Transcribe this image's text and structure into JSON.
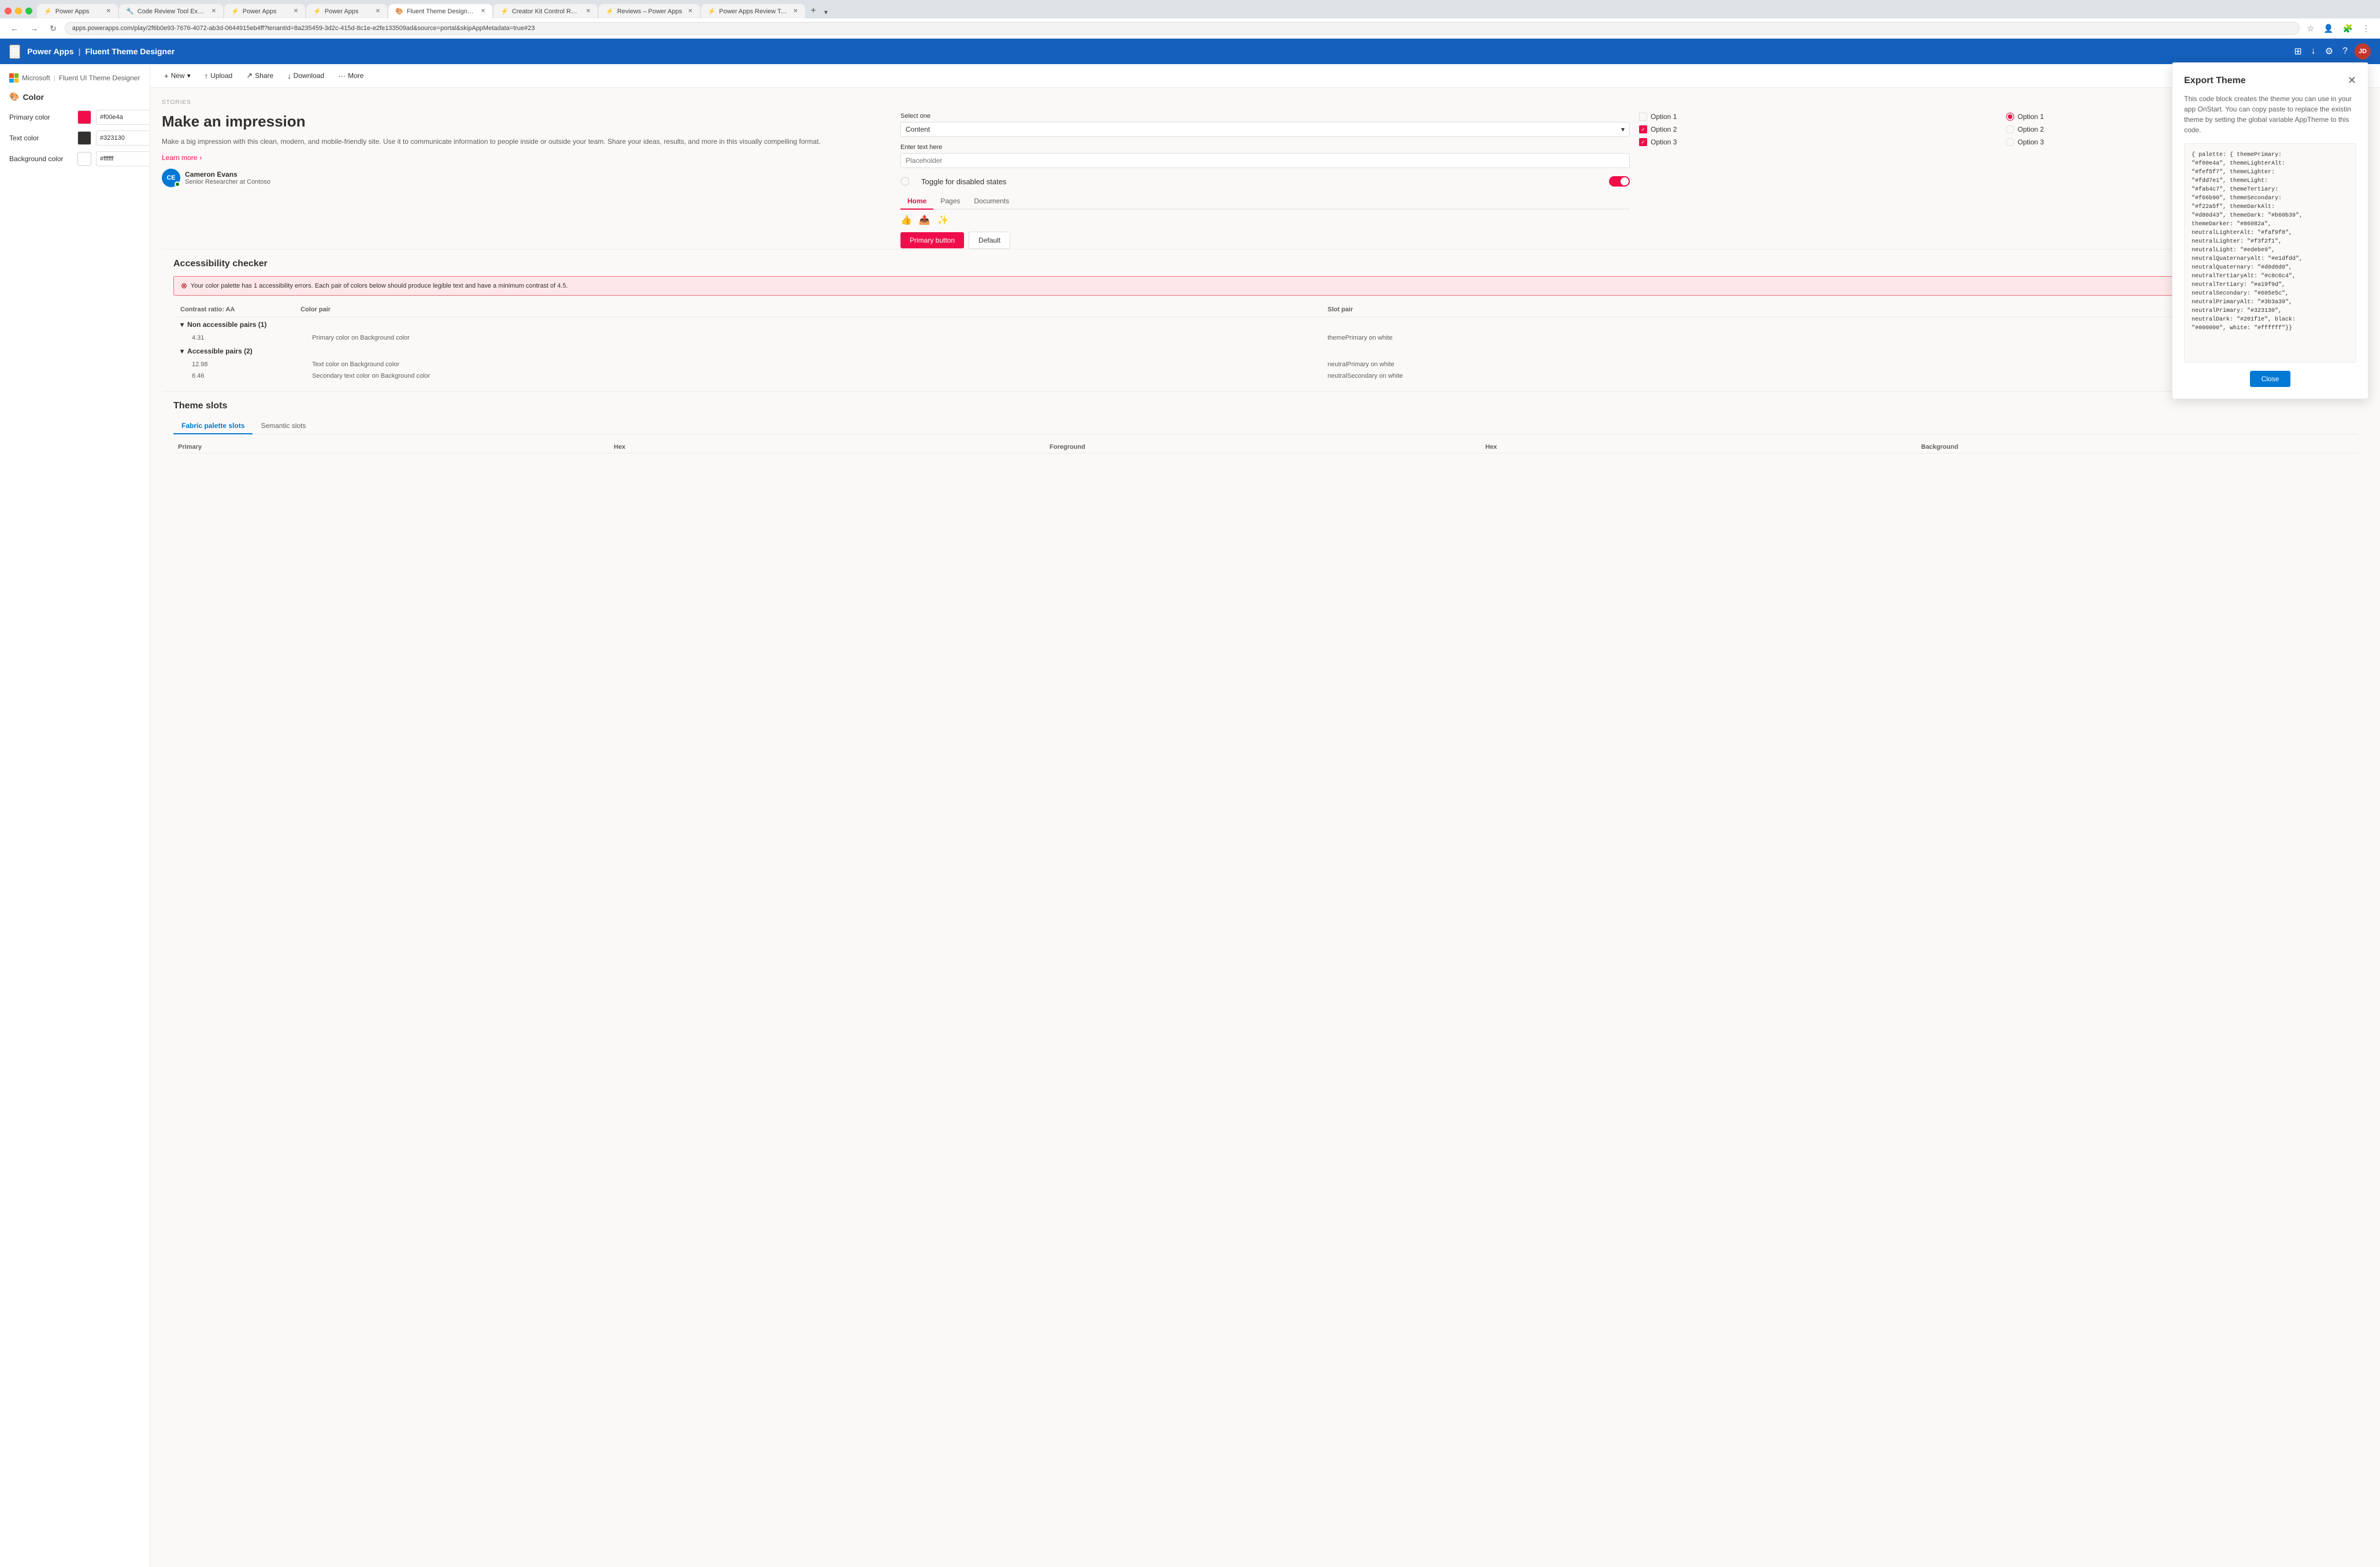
{
  "browser": {
    "tabs": [
      {
        "label": "Power Apps",
        "active": false,
        "favicon": "⚡"
      },
      {
        "label": "Code Review Tool Experim...",
        "active": false,
        "favicon": "🔧"
      },
      {
        "label": "Power Apps",
        "active": false,
        "favicon": "⚡"
      },
      {
        "label": "Power Apps",
        "active": false,
        "favicon": "⚡"
      },
      {
        "label": "Fluent Theme Designer - ...",
        "active": true,
        "favicon": "🎨"
      },
      {
        "label": "Creator Kit Control Refere...",
        "active": false,
        "favicon": "⚡"
      },
      {
        "label": "Reviews – Power Apps",
        "active": false,
        "favicon": "⚡"
      },
      {
        "label": "Power Apps Review Tool ...",
        "active": false,
        "favicon": "⚡"
      }
    ],
    "address": "apps.powerapps.com/play/2f6b0e93-7676-4072-ab3d-0644915eb4ff?tenantId=8a235459-3d2c-415d-8c1e-e2fe133509ad&source=portal&skipAppMetadata=true#23"
  },
  "app_header": {
    "title": "Power Apps",
    "divider": "|",
    "subtitle": "Fluent Theme Designer",
    "avatar_initials": "JD"
  },
  "microsoft_brand": {
    "company": "Microsoft",
    "app_name": "Fluent UI Theme Designer"
  },
  "color_section": {
    "title": "Color",
    "rows": [
      {
        "label": "Primary color",
        "swatch": "#f00e4a",
        "value": "#f00e4a"
      },
      {
        "label": "Text color",
        "swatch": "#323130",
        "value": "#323130"
      },
      {
        "label": "Background color",
        "swatch": "#ffffff",
        "value": "#ffffff"
      }
    ]
  },
  "toolbar": {
    "new_label": "New",
    "upload_label": "Upload",
    "share_label": "Share",
    "download_label": "Download",
    "more_label": "More"
  },
  "stories": {
    "label": "STORIES",
    "heading": "Make an impression",
    "body": "Make a big impression with this clean, modern, and mobile-friendly site. Use it to communicate information to people inside or outside your team. Share your ideas, results, and more in this visually compelling format.",
    "learn_more": "Learn more"
  },
  "form": {
    "select_label": "Select one",
    "select_value": "Content",
    "text_label": "Enter text here",
    "text_placeholder": "Placeholder"
  },
  "options": {
    "checkboxes": [
      {
        "label": "Option 1",
        "checked": false
      },
      {
        "label": "Option 2",
        "checked": true
      },
      {
        "label": "Option 3",
        "checked": true
      }
    ],
    "radios": [
      {
        "label": "Option 1",
        "checked": true
      },
      {
        "label": "Option 2",
        "checked": false
      },
      {
        "label": "Option 3",
        "checked": false
      }
    ]
  },
  "toggle": {
    "label": "Toggle for disabled states",
    "checked": true
  },
  "nav_tabs": [
    {
      "label": "Home",
      "active": true
    },
    {
      "label": "Pages",
      "active": false
    },
    {
      "label": "Documents",
      "active": false
    }
  ],
  "action_buttons": {
    "primary": "Primary button",
    "default": "Default"
  },
  "person": {
    "initials": "CE",
    "name": "Cameron Evans",
    "role": "Senior Researcher at Contoso",
    "online": true
  },
  "accessibility": {
    "section_title": "Accessibility checker",
    "error_message": "Your color palette has 1 accessibility errors. Each pair of colors below should produce legible text and have a minimum contrast of 4.5.",
    "table_headers": [
      "Contrast ratio: AA",
      "Color pair",
      "Slot pair"
    ],
    "non_accessible": {
      "label": "Non accessible pairs (1)",
      "rows": [
        {
          "ratio": "4.31",
          "pair": "Primary color on Background color",
          "slot": "themePrimary on white"
        }
      ]
    },
    "accessible": {
      "label": "Accessible pairs (2)",
      "rows": [
        {
          "ratio": "12.98",
          "pair": "Text color on Background color",
          "slot": "neutralPrimary on white"
        },
        {
          "ratio": "6.46",
          "pair": "Secondary text color on Background color",
          "slot": "neutralSecondary on white"
        }
      ]
    }
  },
  "theme_slots": {
    "section_title": "Theme slots",
    "tabs": [
      {
        "label": "Fabric palette slots",
        "active": true
      },
      {
        "label": "Semantic slots",
        "active": false
      }
    ],
    "table_headers": [
      "Primary",
      "Hex",
      "Foreground",
      "Hex",
      "Background"
    ]
  },
  "export_panel": {
    "title": "Export Theme",
    "description": "This code block creates the theme you can use in your app OnStart. You can copy paste to replace the existin theme by setting the global variable AppTheme to this code.",
    "code": "{ palette: { themePrimary:\n\"#f00e4a\", themeLighterAlt:\n\"#fef5f7\", themeLighter:\n\"#fdd7e1\", themeLight:\n\"#fab4c7\", themeTertiary:\n\"#f66b90\", themeSecondary:\n\"#f22a5f\", themeDarkAlt:\n\"#d80d43\", themeDark: \"#b60b39\",\nthemeDarker: \"#86082a\",\nneutralLighterAlt: \"#faf9f8\",\nneutralLighter: \"#f3f2f1\",\nneutralLight: \"#edebe9\",\nneutralQuaternaryAlt: \"#e1dfdd\",\nneutralQuaternary: \"#d0d0d0\",\nneutralTertiaryAlt: \"#c8c6c4\",\nneutralTertiary: \"#a19f9d\",\nneutralSecondary: \"#605e5c\",\nneutralPrimaryAlt: \"#3b3a39\",\nneutralPrimary: \"#323130\",\nneutralDark: \"#201f1e\", black:\n\"#000000\", white: \"#ffffff\"}}",
    "close_label": "Close"
  }
}
